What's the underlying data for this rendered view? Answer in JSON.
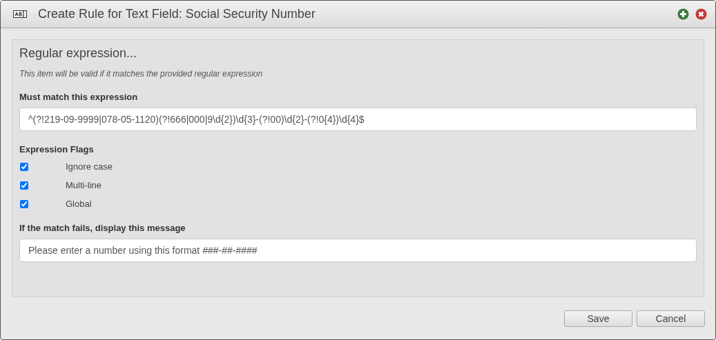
{
  "window": {
    "title": "Create Rule for Text Field: Social Security Number"
  },
  "section": {
    "heading": "Regular expression...",
    "description": "This item will be valid if it matches the provided regular expression"
  },
  "expression": {
    "label": "Must match this expression",
    "value": "^(?!219-09-9999|078-05-1120)(?!666|000|9\\d{2})\\d{3}-(?!00)\\d{2}-(?!0{4})\\d{4}$"
  },
  "flags": {
    "label": "Expression Flags",
    "items": [
      {
        "label": "Ignore case",
        "checked": true
      },
      {
        "label": "Multi-line",
        "checked": true
      },
      {
        "label": "Global",
        "checked": true
      }
    ]
  },
  "message": {
    "label": "If the match fails, display this message",
    "value": "Please enter a number using this format ###-##-####"
  },
  "buttons": [
    "Save",
    "Cancel"
  ]
}
